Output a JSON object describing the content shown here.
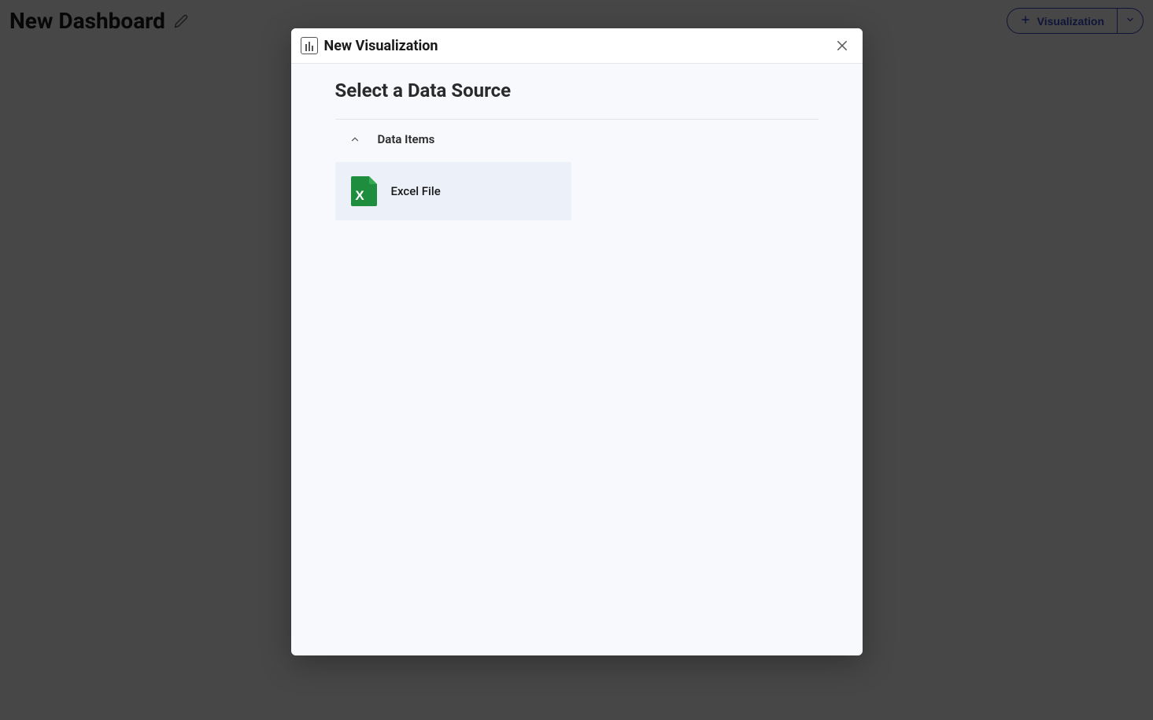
{
  "header": {
    "title": "New Dashboard",
    "visualization_button_label": "Visualization"
  },
  "modal": {
    "title": "New Visualization",
    "section_title": "Select a Data Source",
    "group_label": "Data Items",
    "items": [
      {
        "label": "Excel File",
        "icon": "excel"
      }
    ]
  }
}
